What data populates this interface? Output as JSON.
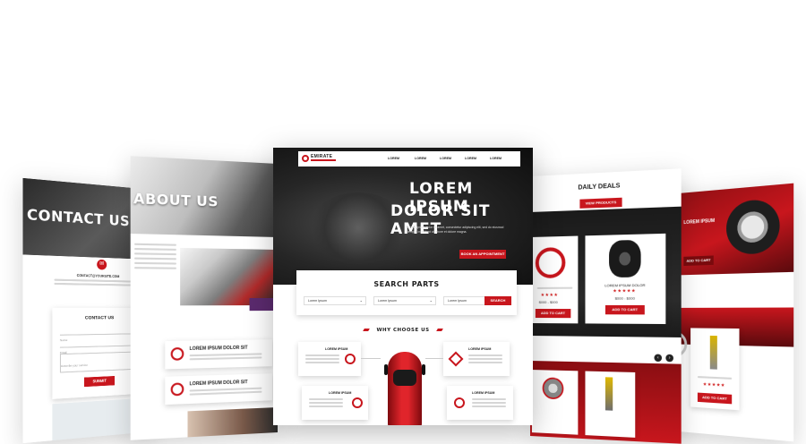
{
  "contact": {
    "heading": "CONTACT US",
    "email": "CONTACT@YOURSITE.COM",
    "form_title": "CONTACT US",
    "fields": [
      "Name",
      "Email",
      "Describe your service"
    ],
    "submit": "SUBMIT"
  },
  "about": {
    "heading": "ABOUT US",
    "items": [
      "LOREM IPSUM DOLOR SIT",
      "LOREM IPSUM DOLOR SIT"
    ]
  },
  "main": {
    "brand": "EMIRATE",
    "nav": [
      "LOREM",
      "LOREM",
      "LOREM",
      "LOREM",
      "LOREM"
    ],
    "hero_line1": "LOREM IPSUM",
    "hero_line2": "DOLOR SIT AMET",
    "hero_text": "Lorem ipsum dolor sit amet, consectetur adipiscing elit, sed do eiusmod tempor incididunt ut labore et dolore magna.",
    "hero_button": "BOOK AN APPOINTMENT",
    "search_title": "SEARCH PARTS",
    "selects": [
      "Lorem Ipsum",
      "Lorem Ipsum",
      "Lorem Ipsum"
    ],
    "search_button": "SEARCH",
    "why_title": "WHY CHOOSE US",
    "features": [
      "LOREM IPSUM",
      "LOREM IPSUM",
      "LOREM IPSUM",
      "LOREM IPSUM"
    ]
  },
  "deals": {
    "heading": "DAILY DEALS",
    "button": "VIEW PRODUCTS",
    "product1": "LOREM IPSUM DOLOR",
    "price": "$000 - $000",
    "add_to_cart": "ADD TO CART"
  },
  "right": {
    "title": "LOREM IPSUM",
    "add_to_cart": "ADD TO CART"
  }
}
